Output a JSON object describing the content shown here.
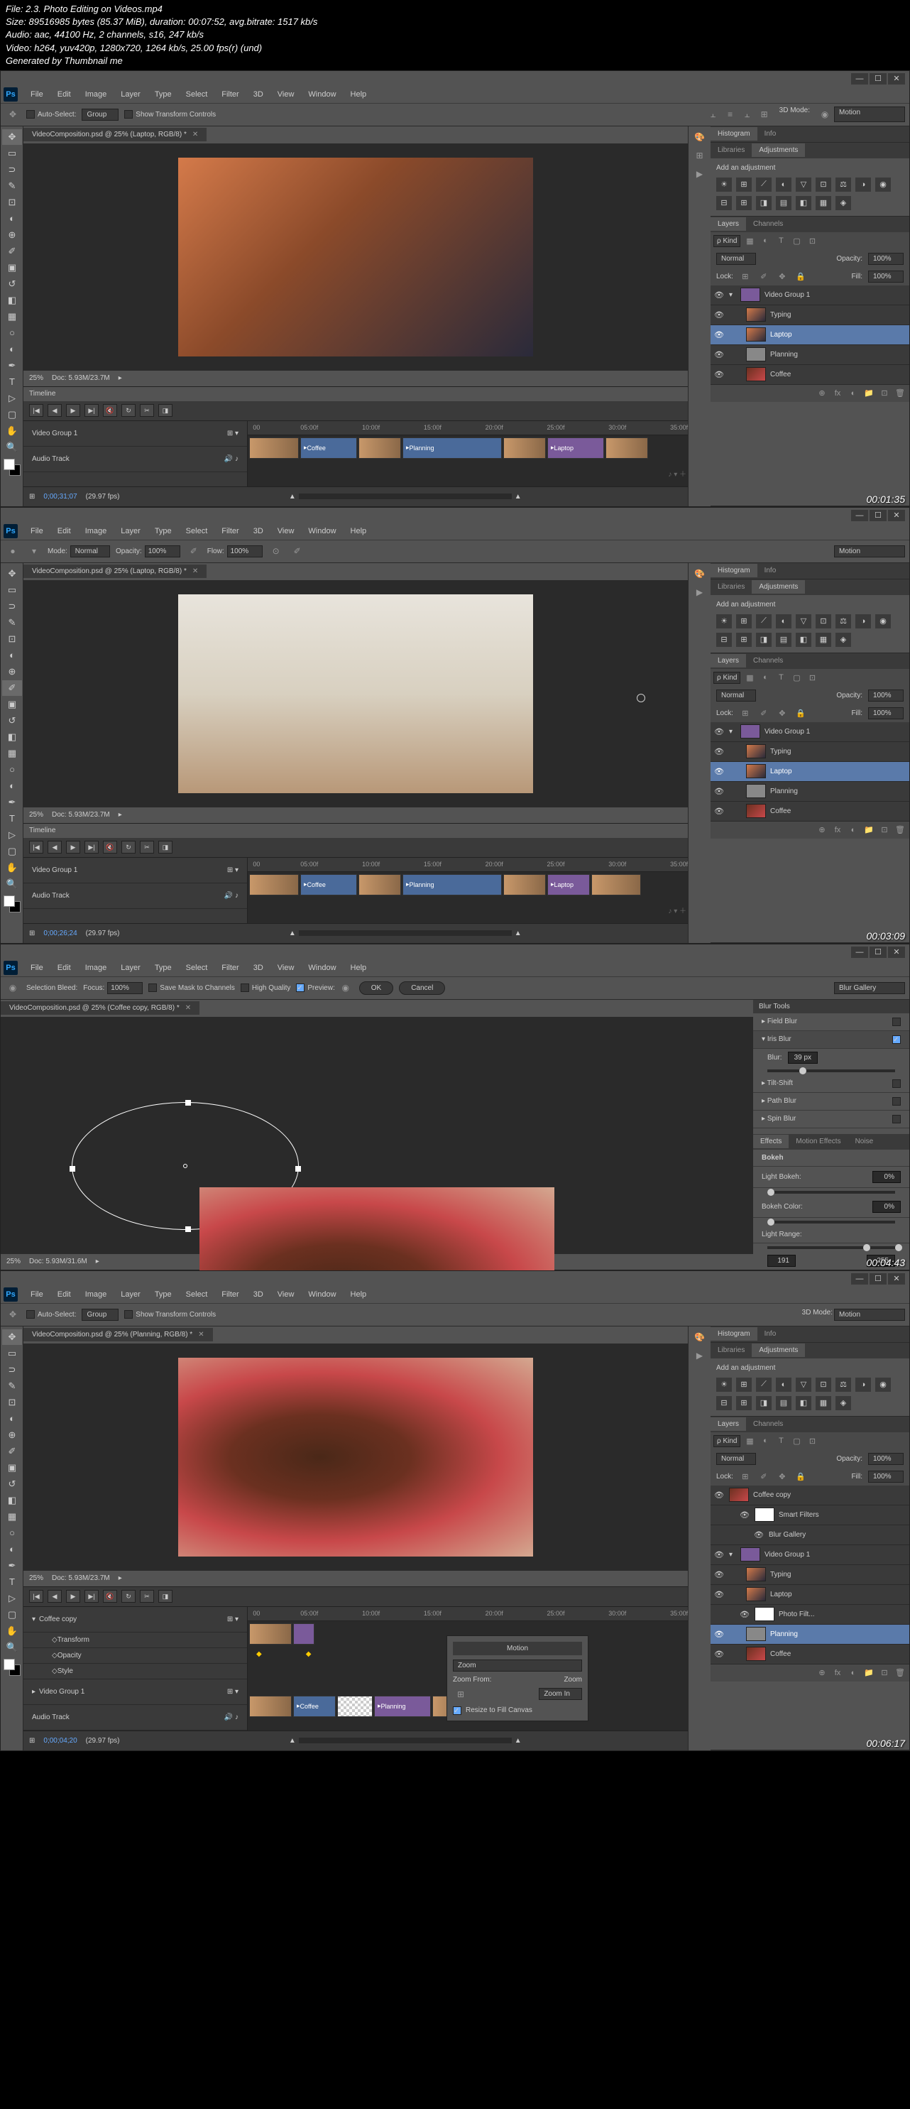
{
  "header": {
    "file": "File: 2.3. Photo Editing on Videos.mp4",
    "size": "Size: 89516985 bytes (85.37 MiB), duration: 00:07:52, avg.bitrate: 1517 kb/s",
    "audio": "Audio: aac, 44100 Hz, 2 channels, s16, 247 kb/s",
    "video": "Video: h264, yuv420p, 1280x720, 1264 kb/s, 25.00 fps(r) (und)",
    "generated": "Generated by Thumbnail me"
  },
  "menus": [
    "File",
    "Edit",
    "Image",
    "Layer",
    "Type",
    "Select",
    "Filter",
    "3D",
    "View",
    "Window",
    "Help"
  ],
  "frame1": {
    "options": {
      "auto_select": "Auto-Select:",
      "group": "Group",
      "show_transform": "Show Transform Controls",
      "workspace": "Motion",
      "mode3d": "3D Mode:"
    },
    "tab": "VideoComposition.psd @ 25% (Laptop, RGB/8) *",
    "status_zoom": "25%",
    "status_doc": "Doc: 5.93M/23.7M",
    "timeline_title": "Timeline",
    "tracks": {
      "video_group": "Video Group 1",
      "audio": "Audio Track"
    },
    "clips": [
      "Coffee",
      "Planning",
      "Laptop"
    ],
    "ruler_ticks": [
      "00",
      "05:00f",
      "10:00f",
      "15:00f",
      "20:00f",
      "25:00f",
      "30:00f",
      "35:00f"
    ],
    "time_display": "0;00;31;07",
    "fps": "(29.97 fps)",
    "timestamp": "00:01:35"
  },
  "frame2": {
    "options": {
      "mode": "Mode:",
      "mode_val": "Normal",
      "opacity": "Opacity:",
      "opacity_val": "100%",
      "flow": "Flow:",
      "flow_val": "100%"
    },
    "tab": "VideoComposition.psd @ 25% (Laptop, RGB/8) *",
    "time_display": "0;00;26;24",
    "timestamp": "00:03:09"
  },
  "frame3": {
    "options": {
      "selection_bleed": "Selection Bleed:",
      "focus": "Focus:",
      "focus_val": "100%",
      "save_mask": "Save Mask to Channels",
      "high_quality": "High Quality",
      "preview": "Preview:",
      "ok": "OK",
      "cancel": "Cancel",
      "workspace": "Blur Gallery"
    },
    "tab": "VideoComposition.psd @ 25% (Coffee copy, RGB/8) *",
    "blur_tools_title": "Blur Tools",
    "blur_types": {
      "field": "Field Blur",
      "iris": "Iris Blur",
      "tilt": "Tilt-Shift",
      "path": "Path Blur",
      "spin": "Spin Blur"
    },
    "blur_label": "Blur:",
    "blur_val": "39 px",
    "effects_tabs": [
      "Effects",
      "Motion Effects",
      "Noise"
    ],
    "effects": {
      "bokeh": "Bokeh",
      "light_bokeh": "Light Bokeh:",
      "light_bokeh_val": "0%",
      "bokeh_color": "Bokeh Color:",
      "bokeh_color_val": "0%",
      "light_range": "Light Range:",
      "range_low": "191",
      "range_high": "255"
    },
    "status_doc": "Doc: 5.93M/31.6M",
    "timestamp": "00:04:43"
  },
  "frame4": {
    "tab": "VideoComposition.psd @ 25% (Planning, RGB/8) *",
    "tracks": {
      "coffee_copy": "Coffee copy",
      "transform": "Transform",
      "opacity": "Opacity",
      "style": "Style",
      "video_group": "Video Group 1",
      "audio": "Audio Track"
    },
    "zoom_popup": {
      "title": "Motion",
      "zoom": "Zoom",
      "zoom_from": "Zoom From:",
      "zoom_in": "Zoom In",
      "resize": "Resize to Fill Canvas"
    },
    "time_display": "0;00;04;20",
    "timestamp": "00:06:17"
  },
  "panels": {
    "histogram": "Histogram",
    "info": "Info",
    "libraries": "Libraries",
    "adjustments": "Adjustments",
    "add_adjustment": "Add an adjustment",
    "layers": "Layers",
    "channels": "Channels",
    "kind": "Kind",
    "normal": "Normal",
    "opacity_label": "Opacity:",
    "opacity_val": "100%",
    "lock": "Lock:",
    "fill": "Fill:",
    "fill_val": "100%"
  },
  "layers": {
    "video_group": "Video Group 1",
    "items": [
      "Typing",
      "Laptop",
      "Planning",
      "Coffee"
    ]
  },
  "layers4": {
    "coffee_copy": "Coffee copy",
    "smart_filters": "Smart Filters",
    "blur_gallery": "Blur Gallery",
    "video_group": "Video Group 1",
    "items": [
      "Typing",
      "Laptop",
      "Photo Filt...",
      "Planning",
      "Coffee"
    ]
  }
}
